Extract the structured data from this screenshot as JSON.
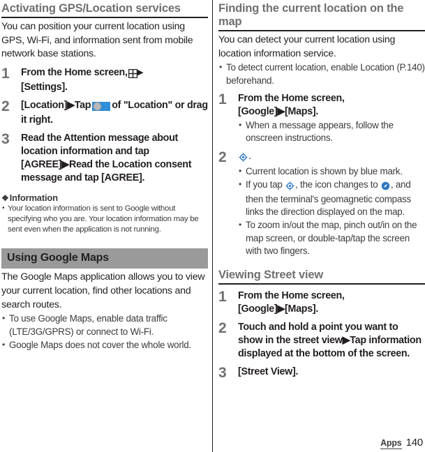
{
  "colors": {
    "heading_gray": "#6f7072",
    "banner_gray": "#9a9a9a",
    "accent_blue": "#2f8fd8",
    "text_dark": "#231f20"
  },
  "left_column": {
    "heading": "Activating GPS/Location services",
    "intro": "You can position your current location using GPS, Wi-Fi, and information sent from mobile network base stations.",
    "steps": [
      {
        "num": "1",
        "text_before_icon": "From the Home screen,",
        "icon": "apps-grid-icon",
        "arrow": "▶",
        "text_after_icon": "[Settings]."
      },
      {
        "num": "2",
        "text_before_icon": "[Location]▶Tap",
        "icon": "toggle-switch-icon",
        "text_after_icon": "of \"Location\" or drag it right."
      },
      {
        "num": "3",
        "text": "Read the Attention message about location information and tap [AGREE]▶Read the Location consent message and tap [AGREE]."
      }
    ],
    "information": {
      "floret": "❖",
      "title": "Information",
      "bullets": [
        "Your location information is sent to Google without specifying who you are. Your location information may be sent even when the application is not running."
      ]
    },
    "banner": "Using Google Maps",
    "maps_intro": "The Google Maps application allows you to view your current location, find other locations and search routes.",
    "maps_bullets": [
      "To use Google Maps, enable data traffic (LTE/3G/GPRS) or connect to Wi-Fi.",
      "Google Maps does not cover the whole world."
    ]
  },
  "right_column": {
    "heading": "Finding the current location on the map",
    "intro": "You can detect your current location using location information service.",
    "intro_bullets": [
      "To detect current location, enable Location (P.140) beforehand."
    ],
    "steps": [
      {
        "num": "1",
        "text": "From the Home screen, [Google]▶[Maps].",
        "bullets": [
          "When a message appears, follow the onscreen instructions."
        ]
      },
      {
        "num": "2",
        "icon": "target-locate-icon",
        "text_after_icon": ".",
        "bullets": [
          "Current location is shown by blue mark.",
          "To zoom in/out the map, pinch out/in on the map screen, or double-tap/tap the screen with two fingers."
        ],
        "icon_bullet": {
          "part1": "If you tap",
          "icon1": "target-locate-icon",
          "part2": ", the icon changes to",
          "icon2": "compass-icon",
          "part3": ", and then the terminal's geomagnetic compass links the direction displayed on the map."
        }
      }
    ],
    "subheading": "Viewing Street view",
    "street_steps": [
      {
        "num": "1",
        "text": "From the Home screen, [Google]▶[Maps]."
      },
      {
        "num": "2",
        "text": "Touch and hold a point you want to show in the street view▶Tap information displayed at the bottom of the screen."
      },
      {
        "num": "3",
        "text": "[Street View]."
      }
    ]
  },
  "footer": {
    "tab": "Apps",
    "page": "140"
  }
}
